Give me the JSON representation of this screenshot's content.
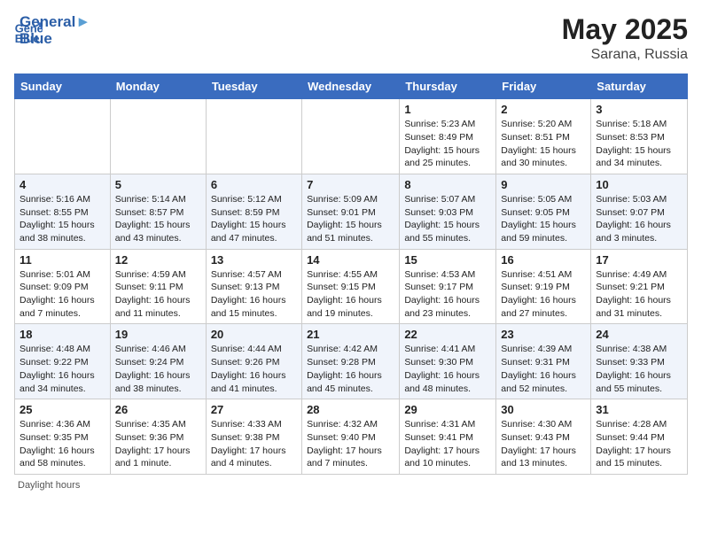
{
  "header": {
    "logo_text_general": "General",
    "logo_text_blue": "Blue",
    "title": "May 2025",
    "location": "Sarana, Russia"
  },
  "days_of_week": [
    "Sunday",
    "Monday",
    "Tuesday",
    "Wednesday",
    "Thursday",
    "Friday",
    "Saturday"
  ],
  "footer": {
    "daylight_label": "Daylight hours"
  },
  "weeks": [
    [
      {
        "day": "",
        "info": ""
      },
      {
        "day": "",
        "info": ""
      },
      {
        "day": "",
        "info": ""
      },
      {
        "day": "",
        "info": ""
      },
      {
        "day": "1",
        "info": "Sunrise: 5:23 AM\nSunset: 8:49 PM\nDaylight: 15 hours\nand 25 minutes."
      },
      {
        "day": "2",
        "info": "Sunrise: 5:20 AM\nSunset: 8:51 PM\nDaylight: 15 hours\nand 30 minutes."
      },
      {
        "day": "3",
        "info": "Sunrise: 5:18 AM\nSunset: 8:53 PM\nDaylight: 15 hours\nand 34 minutes."
      }
    ],
    [
      {
        "day": "4",
        "info": "Sunrise: 5:16 AM\nSunset: 8:55 PM\nDaylight: 15 hours\nand 38 minutes."
      },
      {
        "day": "5",
        "info": "Sunrise: 5:14 AM\nSunset: 8:57 PM\nDaylight: 15 hours\nand 43 minutes."
      },
      {
        "day": "6",
        "info": "Sunrise: 5:12 AM\nSunset: 8:59 PM\nDaylight: 15 hours\nand 47 minutes."
      },
      {
        "day": "7",
        "info": "Sunrise: 5:09 AM\nSunset: 9:01 PM\nDaylight: 15 hours\nand 51 minutes."
      },
      {
        "day": "8",
        "info": "Sunrise: 5:07 AM\nSunset: 9:03 PM\nDaylight: 15 hours\nand 55 minutes."
      },
      {
        "day": "9",
        "info": "Sunrise: 5:05 AM\nSunset: 9:05 PM\nDaylight: 15 hours\nand 59 minutes."
      },
      {
        "day": "10",
        "info": "Sunrise: 5:03 AM\nSunset: 9:07 PM\nDaylight: 16 hours\nand 3 minutes."
      }
    ],
    [
      {
        "day": "11",
        "info": "Sunrise: 5:01 AM\nSunset: 9:09 PM\nDaylight: 16 hours\nand 7 minutes."
      },
      {
        "day": "12",
        "info": "Sunrise: 4:59 AM\nSunset: 9:11 PM\nDaylight: 16 hours\nand 11 minutes."
      },
      {
        "day": "13",
        "info": "Sunrise: 4:57 AM\nSunset: 9:13 PM\nDaylight: 16 hours\nand 15 minutes."
      },
      {
        "day": "14",
        "info": "Sunrise: 4:55 AM\nSunset: 9:15 PM\nDaylight: 16 hours\nand 19 minutes."
      },
      {
        "day": "15",
        "info": "Sunrise: 4:53 AM\nSunset: 9:17 PM\nDaylight: 16 hours\nand 23 minutes."
      },
      {
        "day": "16",
        "info": "Sunrise: 4:51 AM\nSunset: 9:19 PM\nDaylight: 16 hours\nand 27 minutes."
      },
      {
        "day": "17",
        "info": "Sunrise: 4:49 AM\nSunset: 9:21 PM\nDaylight: 16 hours\nand 31 minutes."
      }
    ],
    [
      {
        "day": "18",
        "info": "Sunrise: 4:48 AM\nSunset: 9:22 PM\nDaylight: 16 hours\nand 34 minutes."
      },
      {
        "day": "19",
        "info": "Sunrise: 4:46 AM\nSunset: 9:24 PM\nDaylight: 16 hours\nand 38 minutes."
      },
      {
        "day": "20",
        "info": "Sunrise: 4:44 AM\nSunset: 9:26 PM\nDaylight: 16 hours\nand 41 minutes."
      },
      {
        "day": "21",
        "info": "Sunrise: 4:42 AM\nSunset: 9:28 PM\nDaylight: 16 hours\nand 45 minutes."
      },
      {
        "day": "22",
        "info": "Sunrise: 4:41 AM\nSunset: 9:30 PM\nDaylight: 16 hours\nand 48 minutes."
      },
      {
        "day": "23",
        "info": "Sunrise: 4:39 AM\nSunset: 9:31 PM\nDaylight: 16 hours\nand 52 minutes."
      },
      {
        "day": "24",
        "info": "Sunrise: 4:38 AM\nSunset: 9:33 PM\nDaylight: 16 hours\nand 55 minutes."
      }
    ],
    [
      {
        "day": "25",
        "info": "Sunrise: 4:36 AM\nSunset: 9:35 PM\nDaylight: 16 hours\nand 58 minutes."
      },
      {
        "day": "26",
        "info": "Sunrise: 4:35 AM\nSunset: 9:36 PM\nDaylight: 17 hours\nand 1 minute."
      },
      {
        "day": "27",
        "info": "Sunrise: 4:33 AM\nSunset: 9:38 PM\nDaylight: 17 hours\nand 4 minutes."
      },
      {
        "day": "28",
        "info": "Sunrise: 4:32 AM\nSunset: 9:40 PM\nDaylight: 17 hours\nand 7 minutes."
      },
      {
        "day": "29",
        "info": "Sunrise: 4:31 AM\nSunset: 9:41 PM\nDaylight: 17 hours\nand 10 minutes."
      },
      {
        "day": "30",
        "info": "Sunrise: 4:30 AM\nSunset: 9:43 PM\nDaylight: 17 hours\nand 13 minutes."
      },
      {
        "day": "31",
        "info": "Sunrise: 4:28 AM\nSunset: 9:44 PM\nDaylight: 17 hours\nand 15 minutes."
      }
    ]
  ]
}
